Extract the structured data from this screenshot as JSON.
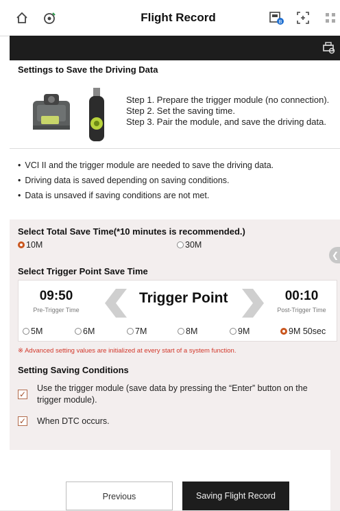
{
  "header": {
    "title": "Flight Record"
  },
  "steps": {
    "section_title": "Settings to Save the Driving Data",
    "items": [
      "Step 1. Prepare the trigger module (no connection).",
      "Step 2. Set the saving time.",
      "Step 3. Pair the module, and save the driving data."
    ]
  },
  "notes": [
    "VCI II and the trigger module are needed to save the driving data.",
    "Driving data is saved depending on saving conditions.",
    "Data is unsaved if saving conditions are not met."
  ],
  "total_save_time": {
    "title": "Select Total Save Time(*10 minutes is recommended.)",
    "options": [
      "10M",
      "30M"
    ],
    "selected": "10M"
  },
  "trigger_point": {
    "title": "Select Trigger Point Save Time",
    "pre_time": "09:50",
    "pre_label": "Pre-Trigger Time",
    "center_label": "Trigger Point",
    "post_time": "00:10",
    "post_label": "Post-Trigger Time",
    "options": [
      "5M",
      "6M",
      "7M",
      "8M",
      "9M",
      "9M 50sec"
    ],
    "selected": "9M 50sec",
    "advanced_note": "※ Advanced setting values are initialized at every start of a system function."
  },
  "conditions": {
    "title": "Setting Saving Conditions",
    "items": [
      {
        "label": "Use the trigger module (save data by pressing the “Enter” button on the trigger module).",
        "checked": true
      },
      {
        "label": "When DTC occurs.",
        "checked": true
      }
    ]
  },
  "buttons": {
    "previous": "Previous",
    "save": "Saving Flight Record"
  },
  "colors": {
    "accent": "#c9561e",
    "dark": "#1d1d1d",
    "settings_bg": "#f3eeee"
  }
}
